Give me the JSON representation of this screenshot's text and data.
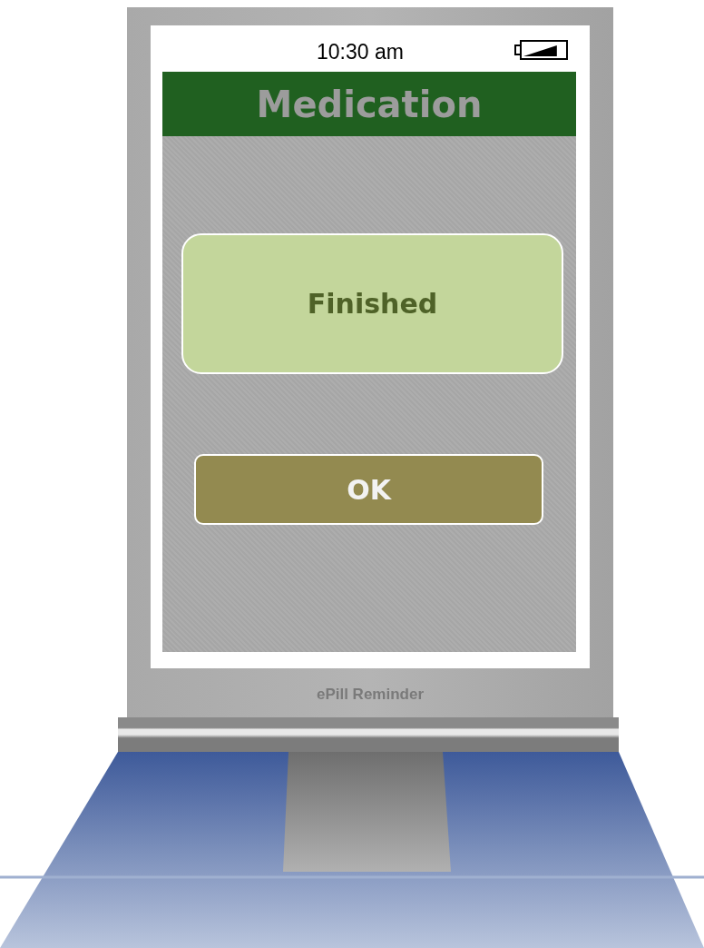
{
  "status_bar": {
    "time": "10:30 am",
    "battery": {
      "level": 0.8
    }
  },
  "header": {
    "title": "Medication"
  },
  "message": {
    "text": "Finished"
  },
  "buttons": [
    {
      "label": "OK"
    }
  ],
  "device": {
    "label": "ePill Reminder"
  }
}
